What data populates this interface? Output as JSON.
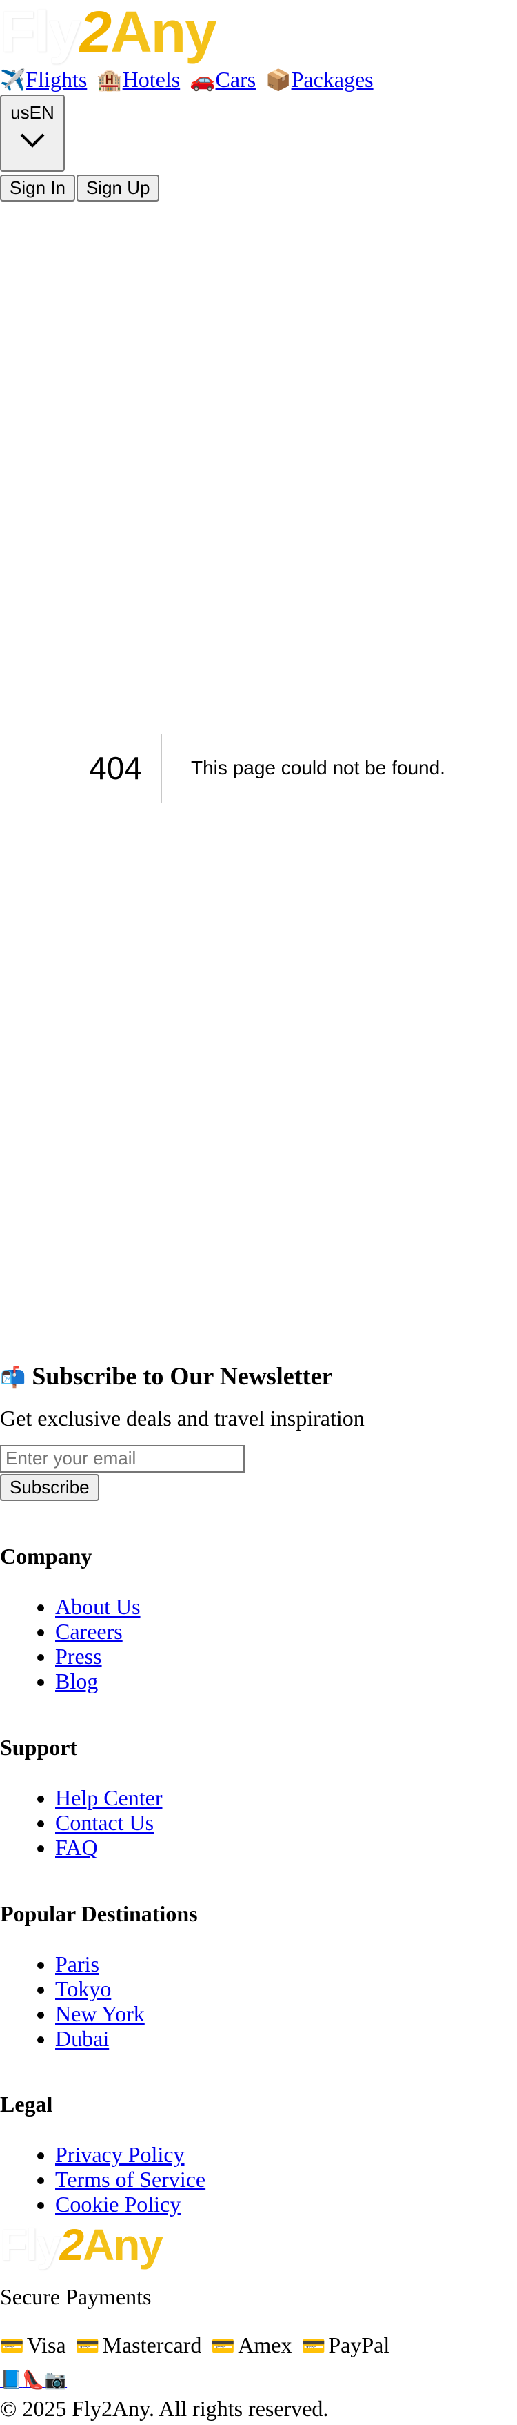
{
  "brand": {
    "fly": "Fly",
    "two": "2",
    "any": "Any"
  },
  "nav": [
    {
      "icon": "✈️",
      "label": "Flights"
    },
    {
      "icon": "🏨",
      "label": "Hotels"
    },
    {
      "icon": "🚗",
      "label": "Cars"
    },
    {
      "icon": "📦",
      "label": "Packages"
    }
  ],
  "language": {
    "region": "us",
    "code": "EN"
  },
  "auth": {
    "sign_in": "Sign In",
    "sign_up": "Sign Up"
  },
  "error": {
    "code": "404",
    "message": "This page could not be found."
  },
  "newsletter": {
    "icon": "📬",
    "title": "Subscribe to Our Newsletter",
    "subtitle": "Get exclusive deals and travel inspiration",
    "placeholder": "Enter your email",
    "button": "Subscribe"
  },
  "footer": {
    "company": {
      "title": "Company",
      "links": [
        "About Us",
        "Careers",
        "Press",
        "Blog"
      ]
    },
    "support": {
      "title": "Support",
      "links": [
        "Help Center",
        "Contact Us",
        "FAQ"
      ]
    },
    "destinations": {
      "title": "Popular Destinations",
      "links": [
        "Paris",
        "Tokyo",
        "New York",
        "Dubai"
      ]
    },
    "legal": {
      "title": "Legal",
      "links": [
        "Privacy Policy",
        "Terms of Service",
        "Cookie Policy"
      ]
    },
    "secure_payments": "Secure Payments",
    "payments": [
      {
        "icon": "💳",
        "label": "Visa"
      },
      {
        "icon": "💳",
        "label": "Mastercard"
      },
      {
        "icon": "💳",
        "label": "Amex"
      },
      {
        "icon": "💳",
        "label": "PayPal"
      }
    ],
    "social": [
      {
        "icon": "📘"
      },
      {
        "icon": "👠"
      },
      {
        "icon": "📷"
      }
    ],
    "copyright": "© 2025 Fly2Any. All rights reserved."
  }
}
